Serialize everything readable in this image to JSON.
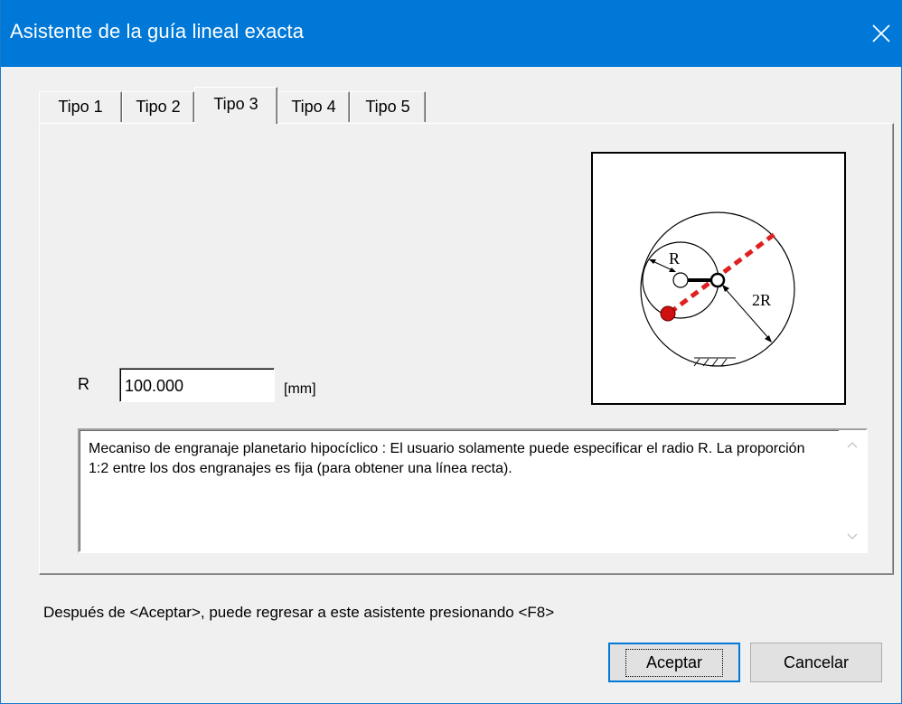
{
  "window": {
    "title": "Asistente de la guía lineal exacta",
    "accent_color": "#0078d7",
    "close_icon": "close-icon"
  },
  "tabs": [
    {
      "label": "Tipo 1",
      "active": false
    },
    {
      "label": "Tipo 2",
      "active": false
    },
    {
      "label": "Tipo 3",
      "active": true
    },
    {
      "label": "Tipo 4",
      "active": false
    },
    {
      "label": "Tipo 5",
      "active": false
    }
  ],
  "form": {
    "r_label": "R",
    "r_value": "100.000",
    "unit": "[mm]"
  },
  "diagram": {
    "label_r": "R",
    "label_2r": "2R",
    "line_color": "#e02020",
    "point_color": "#d01010"
  },
  "description": "Mecaniso de engranaje planetario hipocíclico : El usuario solamente puede especificar el radio R. La proporción 1:2 entre los dos engranajes es fija (para obtener una línea recta).",
  "hint": "Después de <Aceptar>, puede regresar a este asistente presionando <F8>",
  "buttons": {
    "ok": "Aceptar",
    "cancel": "Cancelar"
  }
}
